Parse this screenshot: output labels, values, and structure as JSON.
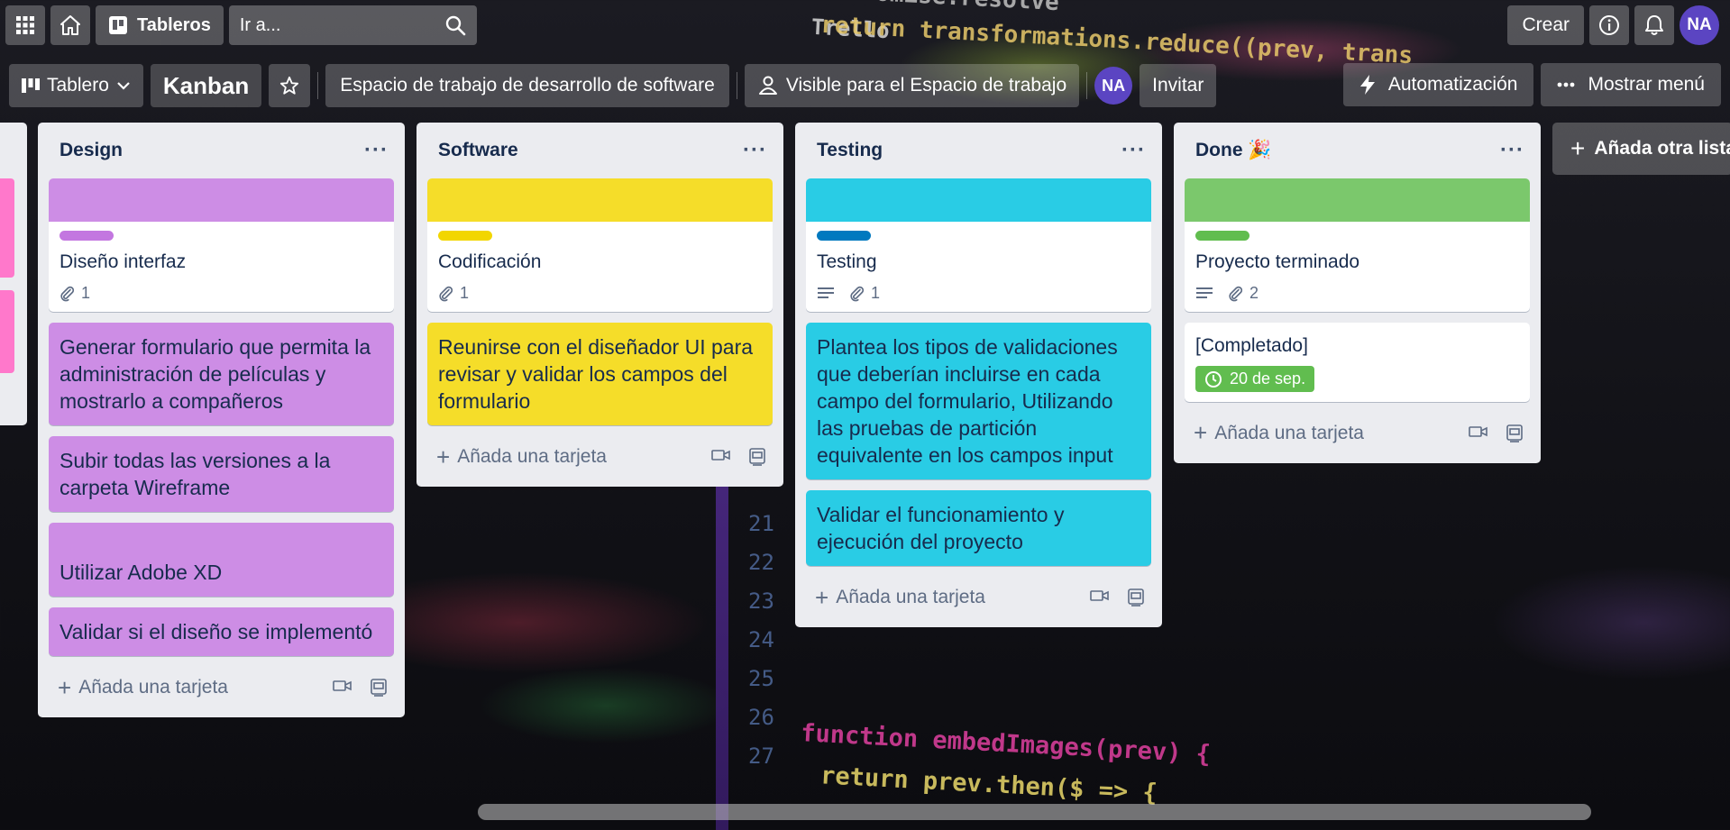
{
  "nav": {
    "boards_label": "Tableros",
    "search_placeholder": "Ir a...",
    "create_label": "Crear",
    "user_initials": "NA"
  },
  "board": {
    "view_label": "Tablero",
    "title": "Kanban",
    "workspace": "Espacio de trabajo de desarrollo de software",
    "visibility": "Visible para el Espacio de trabajo",
    "member_initials": "NA",
    "invite": "Invitar",
    "automation": "Automatización",
    "show_menu": "Mostrar menú"
  },
  "lists": {
    "design": {
      "title": "Design",
      "label_color": "#c377e0",
      "card1": {
        "title": "Diseño interfaz",
        "attachments": "1"
      },
      "card2": "Generar formulario que permita la administración de películas y mostrarlo a compañeros",
      "card3": "Subir todas las versiones a la carpeta Wireframe",
      "card4": "Utilizar Adobe XD",
      "card5": "Validar si el diseño se implementó",
      "add": "Añada una tarjeta"
    },
    "software": {
      "title": "Software",
      "label_color": "#f2d600",
      "card1": {
        "title": "Codificación",
        "attachments": "1"
      },
      "card2": "Reunirse con el diseñador UI para revisar y validar los campos del formulario",
      "add": "Añada una tarjeta"
    },
    "testing": {
      "title": "Testing",
      "label_color": "#0079bf",
      "card1": {
        "title": "Testing",
        "attachments": "1"
      },
      "card2": "Plantea los tipos de validaciones que deberían incluirse en cada campo del formulario, Utilizando las pruebas de partición equivalente en los campos input",
      "card3": "Validar el funcionamiento y ejecución del proyecto",
      "add": "Añada una tarjeta"
    },
    "done": {
      "title": "Done 🎉",
      "label_color": "#61bd4f",
      "card1": {
        "title": "Proyecto terminado",
        "attachments": "2"
      },
      "card2": {
        "title": "[Completado]",
        "due": "20 de sep."
      },
      "add": "Añada una tarjeta"
    }
  },
  "add_list": "Añada otra lista",
  "background_code": {
    "line1": "Promise.resolve",
    "line2": "return transformations.reduce((prev, trans",
    "line3": "function embedImages(prev) {",
    "line4": "return prev.then($ => {",
    "watermark": "Trello",
    "line_numbers": [
      "21",
      "22",
      "23",
      "24",
      "25",
      "26",
      "27"
    ]
  },
  "colors": {
    "design": "#cd8de5",
    "software": "#f5dd29",
    "testing": "#29cce5",
    "done": "#7bc86c"
  }
}
